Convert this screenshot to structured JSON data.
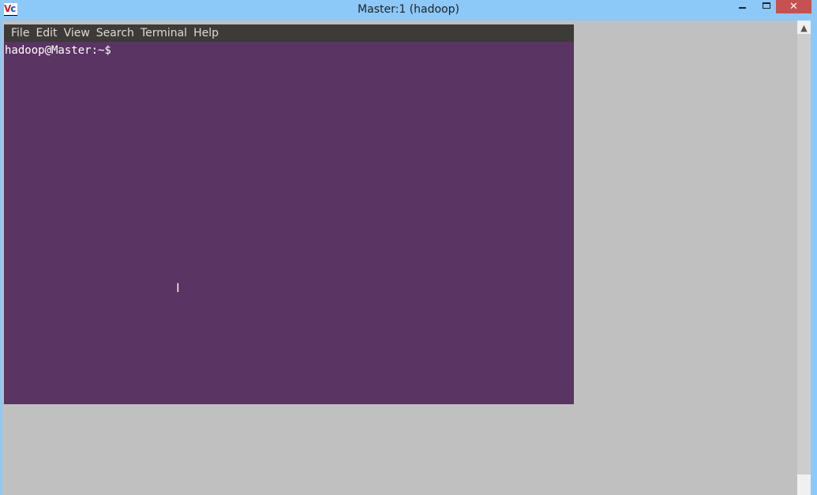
{
  "window": {
    "title": "Master:1 (hadoop)",
    "app_icon": "vnc-icon",
    "close_glyph": "✕"
  },
  "terminal": {
    "menu": [
      "File",
      "Edit",
      "View",
      "Search",
      "Terminal",
      "Help"
    ],
    "prompt": "hadoop@Master:~$",
    "background": "#5a3462"
  },
  "scrollbar": {
    "up_glyph": "▲",
    "position_percent": 0
  }
}
